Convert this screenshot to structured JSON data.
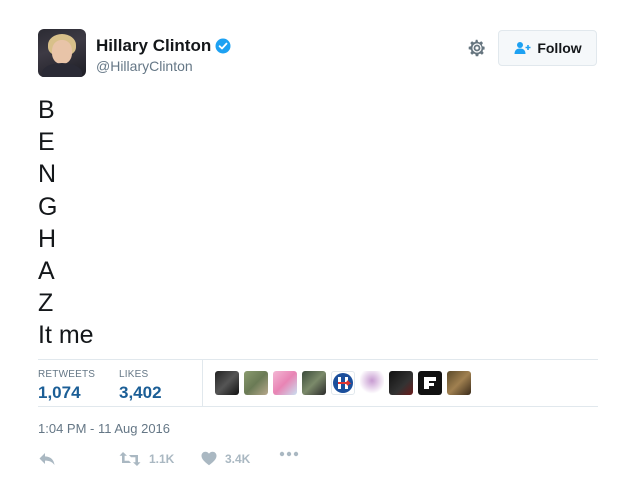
{
  "user": {
    "display_name": "Hillary Clinton",
    "handle": "@HillaryClinton",
    "verified": true
  },
  "header": {
    "follow_label": "Follow"
  },
  "tweet": {
    "lines": [
      "B",
      "E",
      "N",
      "G",
      "H",
      "A",
      "Z",
      "It me"
    ],
    "timestamp": "1:04 PM - 11 Aug 2016"
  },
  "stats": {
    "retweets_label": "RETWEETS",
    "retweets_value": "1,074",
    "likes_label": "LIKES",
    "likes_value": "3,402"
  },
  "actions": {
    "retweet_count": "1.1K",
    "like_count": "3.4K"
  },
  "colors": {
    "link_blue": "#1b5e96",
    "verified_blue": "#1da1f2",
    "muted_gray": "#657786",
    "icon_gray": "#aab8c2"
  }
}
